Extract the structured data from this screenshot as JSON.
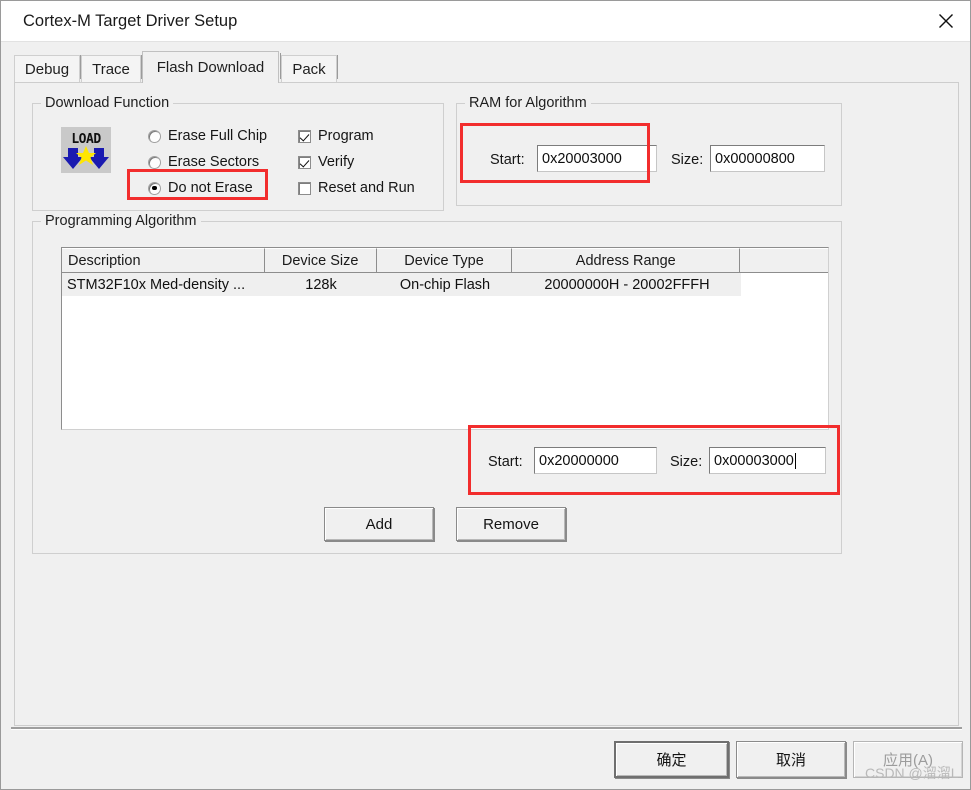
{
  "window": {
    "title": "Cortex-M Target Driver Setup",
    "close_icon": "close-icon"
  },
  "tabs": [
    {
      "label": "Debug",
      "active": false
    },
    {
      "label": "Trace",
      "active": false
    },
    {
      "label": "Flash Download",
      "active": true
    },
    {
      "label": "Pack",
      "active": false
    }
  ],
  "download_function": {
    "title": "Download Function",
    "icon": "load-icon",
    "erase_mode_options": [
      {
        "label": "Erase Full Chip",
        "checked": false
      },
      {
        "label": "Erase Sectors",
        "checked": false
      },
      {
        "label": "Do not Erase",
        "checked": true
      }
    ],
    "checkboxes": [
      {
        "label": "Program",
        "checked": true
      },
      {
        "label": "Verify",
        "checked": true
      },
      {
        "label": "Reset and Run",
        "checked": false
      }
    ]
  },
  "ram_for_algorithm": {
    "title": "RAM for Algorithm",
    "start_label": "Start:",
    "start_value": "0x20003000",
    "size_label": "Size:",
    "size_value": "0x00000800"
  },
  "programming_algorithm": {
    "title": "Programming Algorithm",
    "columns": [
      "Description",
      "Device Size",
      "Device Type",
      "Address Range",
      ""
    ],
    "rows": [
      {
        "description": "STM32F10x Med-density ...",
        "device_size": "128k",
        "device_type": "On-chip Flash",
        "address_range": "20000000H - 20002FFFH",
        "extra": ""
      }
    ],
    "start_label": "Start:",
    "start_value": "0x20000000",
    "size_label": "Size:",
    "size_value": "0x00003000",
    "add_label": "Add",
    "remove_label": "Remove"
  },
  "footer": {
    "ok_label": "确定",
    "cancel_label": "取消",
    "apply_label": "应用(A)",
    "apply_disabled": true
  },
  "watermark": {
    "text": "CSDN @溜溜L"
  },
  "colors": {
    "annotation": "#f22d2d",
    "dialog_bg": "#f0f0f0",
    "titlebar_bg": "#ffffff",
    "field_bg": "#ffffff"
  }
}
